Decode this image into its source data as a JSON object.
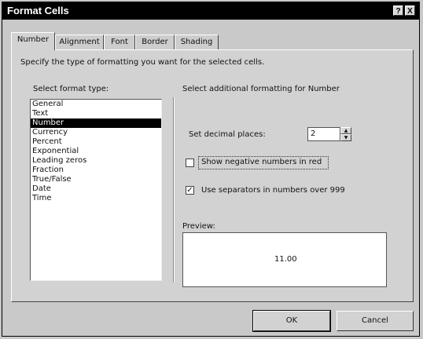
{
  "window": {
    "title": "Format Cells",
    "help_glyph": "?",
    "close_glyph": "X"
  },
  "tabs": [
    {
      "label": "Number",
      "active": true
    },
    {
      "label": "Alignment"
    },
    {
      "label": "Font"
    },
    {
      "label": "Border"
    },
    {
      "label": "Shading"
    }
  ],
  "instruction": "Specify the type of formatting you want for the selected cells.",
  "format_list": {
    "label": "Select format type:",
    "items": [
      "General",
      "Text",
      "Number",
      "Currency",
      "Percent",
      "Exponential",
      "Leading zeros",
      "Fraction",
      "True/False",
      "Date",
      "Time"
    ],
    "selected": "Number"
  },
  "options": {
    "heading": "Select additional formatting for Number",
    "decimal_label": "Set decimal places:",
    "decimal_value": "2",
    "negative_red_label": "Show negative numbers in red",
    "negative_red_checked": false,
    "separators_label": "Use separators in numbers over 999",
    "separators_checked": true,
    "check_glyph": "✓",
    "spin_up": "▲",
    "spin_down": "▼"
  },
  "preview": {
    "label": "Preview:",
    "value": "11.00"
  },
  "buttons": {
    "ok": "OK",
    "cancel": "Cancel"
  }
}
